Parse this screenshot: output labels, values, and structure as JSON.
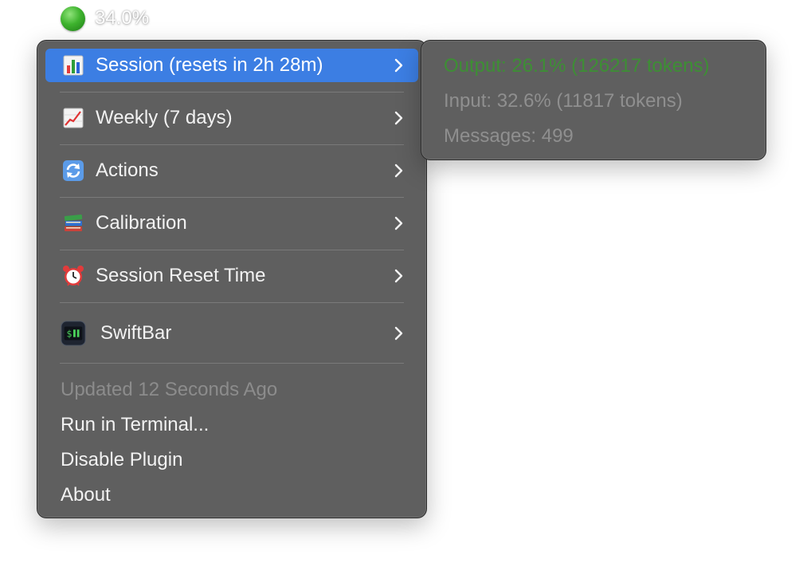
{
  "status_bar": {
    "text": "34.0%",
    "indicator_color": "#3fb42f"
  },
  "menu": {
    "items": [
      {
        "label": "Session (resets in 2h 28m)",
        "icon": "bar-chart-icon",
        "selected": true
      },
      {
        "label": "Weekly (7 days)",
        "icon": "trend-chart-icon",
        "selected": false
      },
      {
        "label": "Actions",
        "icon": "refresh-icon",
        "selected": false
      },
      {
        "label": "Calibration",
        "icon": "books-icon",
        "selected": false
      },
      {
        "label": "Session Reset Time",
        "icon": "alarm-clock-icon",
        "selected": false
      },
      {
        "label": "SwiftBar",
        "icon": "swiftbar-app-icon",
        "selected": false
      }
    ],
    "footer": {
      "updated": "Updated 12 Seconds Ago",
      "run_in_terminal": "Run in Terminal...",
      "disable_plugin": "Disable Plugin",
      "about": "About"
    },
    "selection_color": "#3c7ee3"
  },
  "submenu": {
    "output": "Output: 26.1% (126217 tokens)",
    "output_color": "#3d8f34",
    "input": "Input:  32.6% (11817 tokens)",
    "messages": "Messages: 499"
  }
}
